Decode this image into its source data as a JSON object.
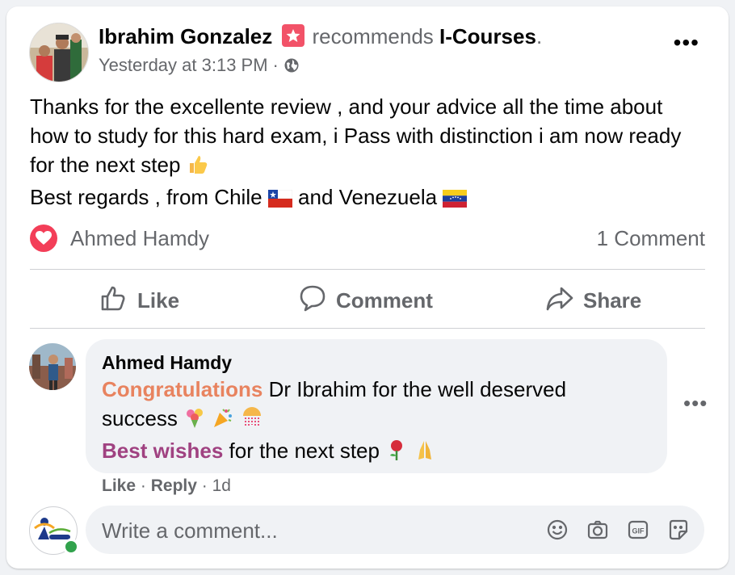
{
  "post": {
    "author": "Ibrahim Gonzalez",
    "verb": "recommends",
    "page": "I-Courses",
    "period": ".",
    "time": "Yesterday at 3:13 PM",
    "separator": "·",
    "privacy_icon": "globe-icon",
    "lines": [
      "Thanks for the  excellente review , and your advice all the time about",
      "how to study for this hard exam, i Pass with distinction i am now ready",
      "for the next step",
      "Best regards , from Chile",
      "and Venezuela"
    ]
  },
  "reactions": {
    "icon": "love-icon",
    "reactor": "Ahmed Hamdy",
    "comment_count": "1 Comment"
  },
  "actions": {
    "like": "Like",
    "comment": "Comment",
    "share": "Share"
  },
  "comment": {
    "author": "Ahmed Hamdy",
    "highlight1": "Congratulations",
    "text1": " Dr Ibrahim for the well deserved",
    "text2": "success",
    "highlight2": "Best wishes",
    "text3": " for the next step",
    "like": "Like",
    "reply": "Reply",
    "dot": "·",
    "age": "1d"
  },
  "composer": {
    "placeholder": "Write a comment..."
  },
  "colors": {
    "accent_orange": "#e8835f",
    "accent_purple": "#a04281",
    "love": "#f33e58",
    "online": "#31a24c"
  }
}
